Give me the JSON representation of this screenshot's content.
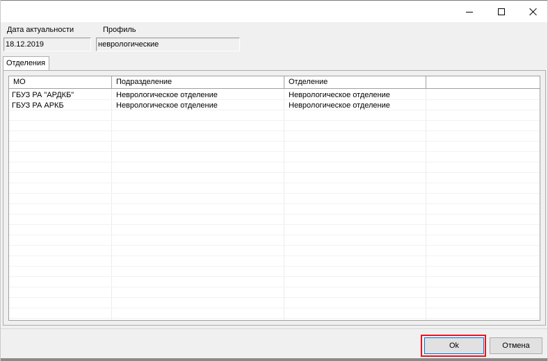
{
  "window": {
    "controls": {
      "minimize": "minimize-icon",
      "maximize": "maximize-icon",
      "close": "close-icon"
    }
  },
  "form": {
    "date_label": "Дата актуальности",
    "date_value": "18.12.2019",
    "profile_label": "Профиль",
    "profile_value": "неврологические"
  },
  "tabs": [
    {
      "label": "Отделения",
      "active": true
    }
  ],
  "grid": {
    "columns": [
      "МО",
      "Подразделение",
      "Отделение",
      ""
    ],
    "rows": [
      [
        "ГБУЗ РА \"АРДКБ\"",
        "Неврологическое отделение",
        "Неврологическое отделение",
        ""
      ],
      [
        "ГБУЗ РА АРКБ",
        "Неврологическое отделение",
        "Неврологическое отделение",
        ""
      ]
    ]
  },
  "buttons": {
    "ok": "Ok",
    "cancel": "Отмена"
  },
  "colors": {
    "highlight": "#e8141b",
    "focus_border": "#0078d7"
  }
}
